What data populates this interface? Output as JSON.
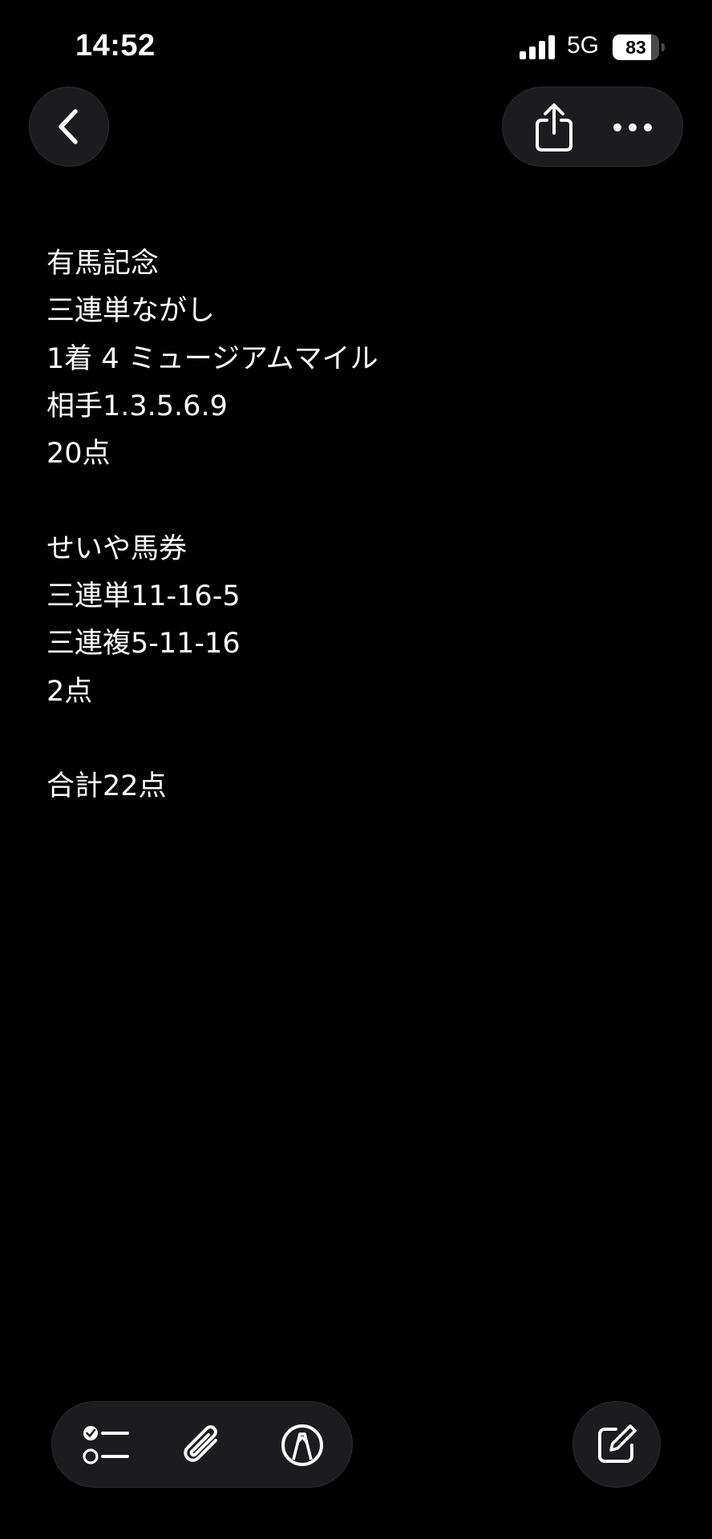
{
  "status_bar": {
    "time": "14:52",
    "network": "5G",
    "battery_level": "83",
    "battery_fraction": 0.83
  },
  "nav": {
    "back_icon": "chevron-left-icon",
    "share_icon": "share-icon",
    "more_icon": "ellipsis-icon"
  },
  "note": {
    "lines": [
      "有馬記念",
      "三連単ながし",
      "1着 4 ミュージアムマイル",
      "相手1.3.5.6.9",
      "20点",
      "",
      "せいや馬券",
      "三連単11-16-5",
      "三連複5-11-16",
      "2点",
      "",
      "合計22点"
    ]
  },
  "toolbar": {
    "checklist_icon": "checklist-icon",
    "attachment_icon": "paperclip-icon",
    "markup_icon": "markup-pen-icon",
    "compose_icon": "compose-icon"
  },
  "colors": {
    "background": "#000000",
    "button_bg": "#1c1c1e",
    "text": "#ffffff"
  }
}
